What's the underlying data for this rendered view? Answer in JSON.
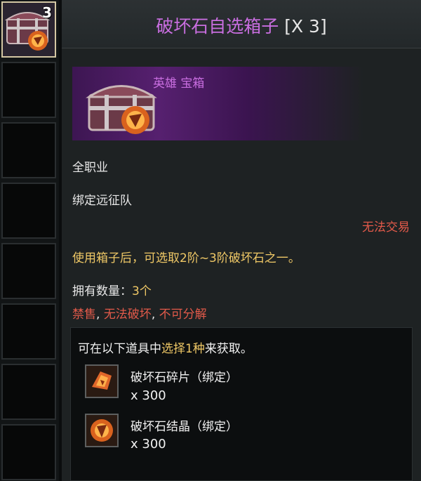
{
  "inventory": {
    "first_slot_count": "3",
    "slot_count": 8
  },
  "item": {
    "name": "破坏石自选箱子",
    "quantity_tag": "[X 3]",
    "rarity": "英雄 宝箱",
    "class": "全职业",
    "binding": "绑定远征队",
    "trade": "无法交易",
    "description": "使用箱子后，可选取2阶~3阶破坏石之一。",
    "owned_label": "拥有数量：",
    "owned_value": "3个",
    "restrictions": {
      "r1": "禁售",
      "sep": ", ",
      "r2": "无法破坏",
      "r3": "不可分解"
    },
    "choice": {
      "prefix": "可在以下道具中",
      "highlight": "选择1种",
      "suffix": "来获取。",
      "options": [
        {
          "name": "破坏石碎片（绑定）",
          "qty": "x 300",
          "icon": "destruction-stone-fragment-icon"
        },
        {
          "name": "破坏石结晶（绑定）",
          "qty": "x 300",
          "icon": "destruction-stone-crystal-icon"
        }
      ]
    }
  },
  "colors": {
    "hero_purple": "#c96ee0",
    "gold": "#efc866",
    "red": "#e25a4a"
  }
}
